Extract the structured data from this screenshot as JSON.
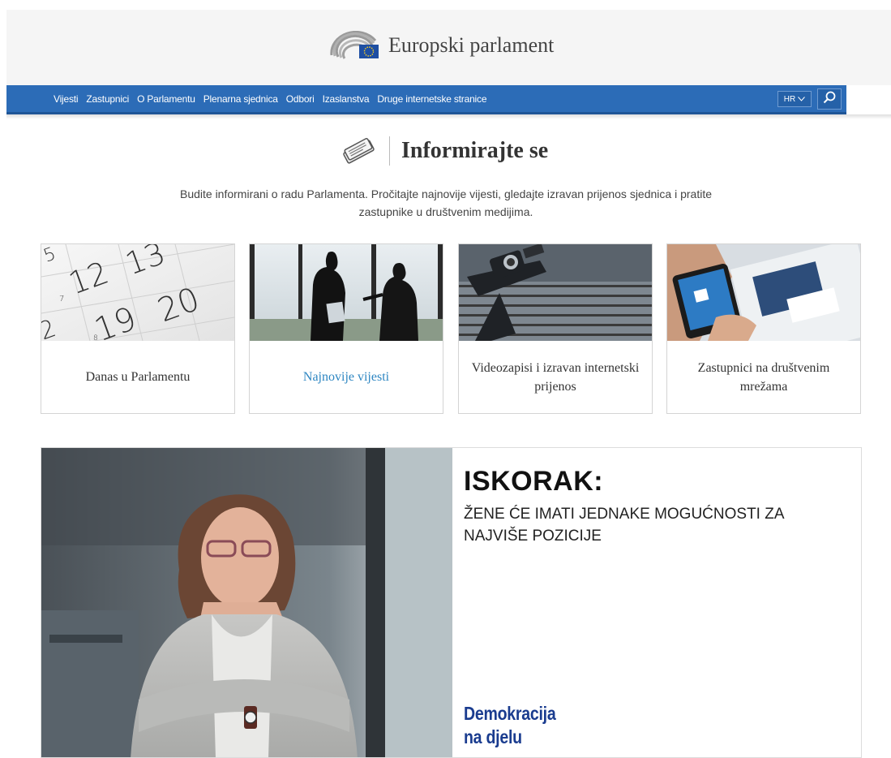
{
  "header": {
    "brand_name": "Europski parlament"
  },
  "nav": {
    "items": [
      {
        "label": "Vijesti"
      },
      {
        "label": "Zastupnici"
      },
      {
        "label": "O Parlamentu"
      },
      {
        "label": "Plenarna sjednica"
      },
      {
        "label": "Odbori"
      },
      {
        "label": "Izaslanstva"
      },
      {
        "label": "Druge internetske stranice"
      }
    ],
    "language": "HR",
    "search_icon": "search-icon",
    "color": "#2c6cb7"
  },
  "section": {
    "title": "Informirajte se",
    "icon": "newspaper-icon",
    "intro": "Budite informirani o radu Parlamenta. Pročitajte najnovije vijesti, gledajte izravan prijenos sjednica i pratite zastupnike u društvenim medijima."
  },
  "cards": [
    {
      "label": "Danas u Parlamentu",
      "image": "calendar-photo"
    },
    {
      "label": "Najnovije vijesti",
      "image": "interview-photo",
      "active": true
    },
    {
      "label": "Videozapisi i izravan internetski prijenos",
      "image": "camera-photo"
    },
    {
      "label": "Zastupnici na društvenim mrežama",
      "image": "smartphone-photo"
    }
  ],
  "banner": {
    "title": "ISKORAK:",
    "subtitle": "ŽENE ĆE IMATI JEDNAKE MOGUĆNOSTI ZA NAJVIŠE POZICIJE",
    "slogan_line1": "Demokracija",
    "slogan_line2": "na djelu",
    "slogan_color": "#1a3c8f",
    "image": "woman-portrait-photo"
  },
  "colors": {
    "link_active": "#2d86c2"
  }
}
